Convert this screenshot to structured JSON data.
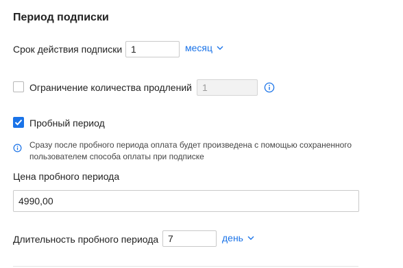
{
  "section": {
    "title": "Период подписки"
  },
  "subscription_term": {
    "label": "Срок действия подписки",
    "value": "1",
    "unit": "месяц"
  },
  "renewal_limit": {
    "label": "Ограничение количества продлений",
    "value": "1",
    "checked": false
  },
  "trial": {
    "label": "Пробный период",
    "checked": true,
    "info_line1": "Сразу после пробного периода оплата будет произведена с помощью сохраненного",
    "info_line2": "пользователем способа оплаты при подписке"
  },
  "trial_price": {
    "label": "Цена пробного периода",
    "value": "4990,00"
  },
  "trial_duration": {
    "label": "Длительность пробного периода",
    "value": "7",
    "unit": "день"
  },
  "colors": {
    "accent": "#1a73e8",
    "border": "#c9c9c9"
  }
}
